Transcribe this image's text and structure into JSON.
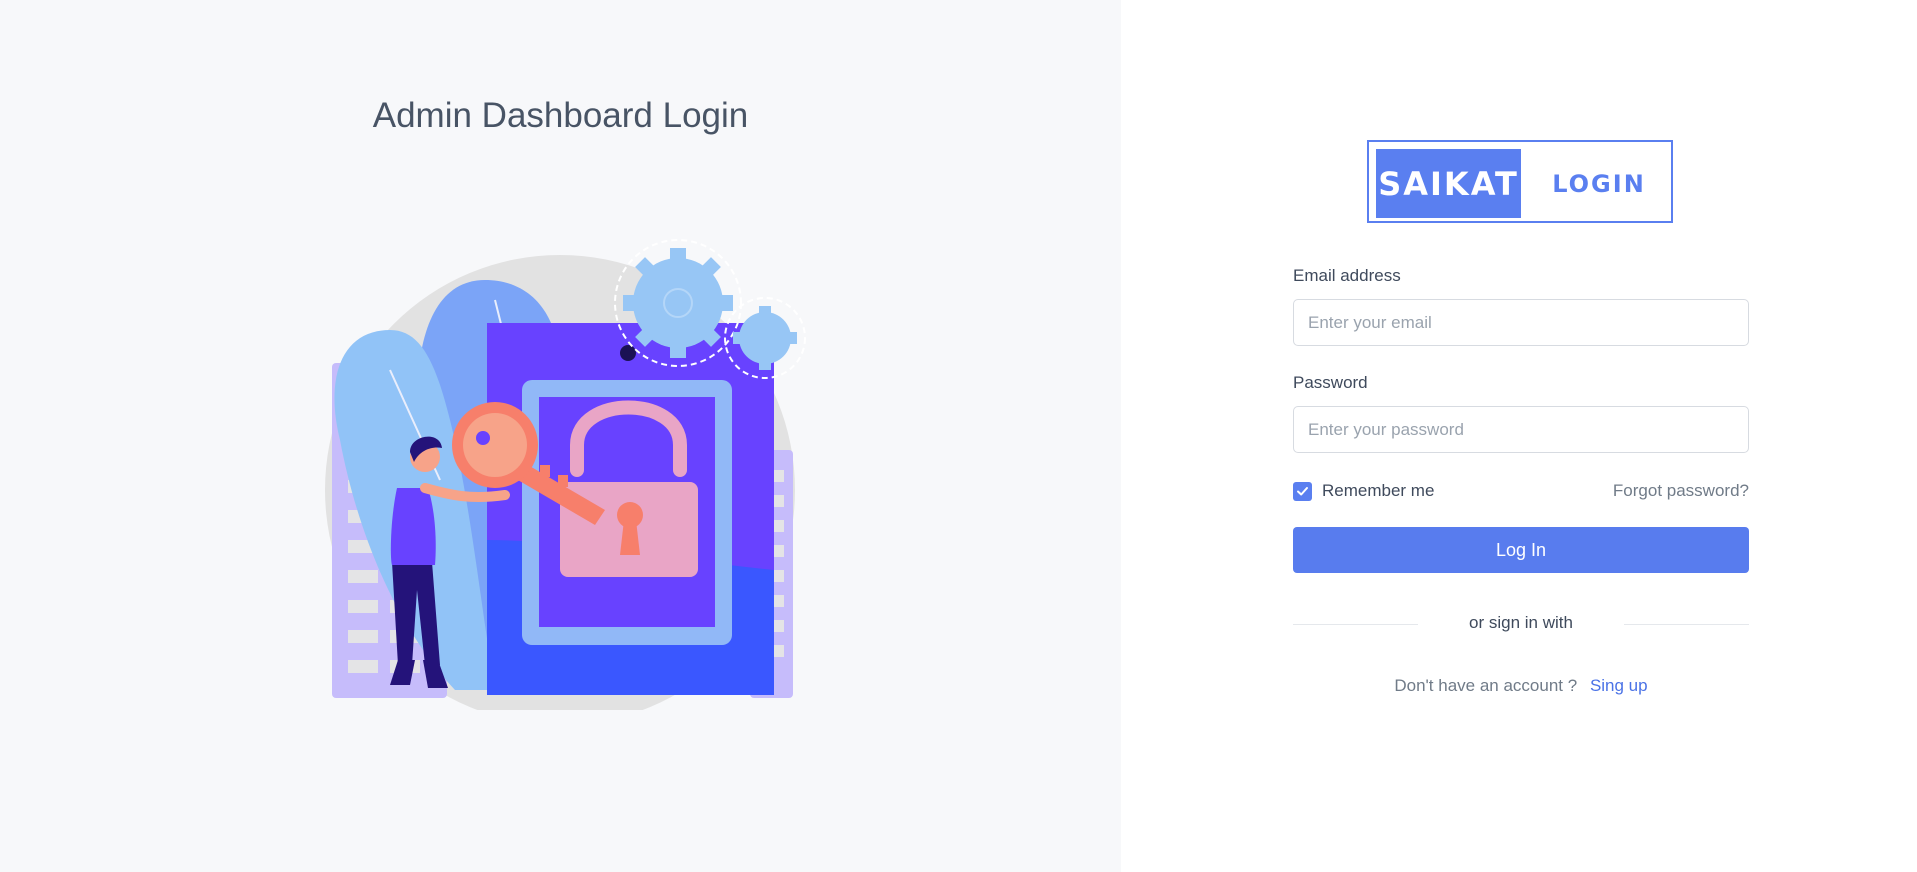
{
  "page": {
    "title": "Admin Dashboard Login"
  },
  "logo": {
    "left_text": "SAIKAT",
    "right_text": "LOGIN"
  },
  "form": {
    "email_label": "Email address",
    "email_placeholder": "Enter your email",
    "email_value": "",
    "password_label": "Password",
    "password_placeholder": "Enter your password",
    "password_value": "",
    "remember_label": "Remember me",
    "remember_checked": true,
    "forgot_link": "Forgot password?",
    "login_button": "Log In",
    "divider_text": "or sign in with",
    "signup_question": "Don't have an account ?",
    "signup_link": "Sing up"
  },
  "colors": {
    "accent": "#587cee",
    "left_background": "#f7f8fa",
    "illustration_purple": "#6842ff",
    "illustration_blue": "#3a57ff",
    "illustration_coral": "#f77f6b"
  },
  "icons": {
    "checkbox": "check-icon",
    "illustration": "padlock-key-illustration"
  }
}
